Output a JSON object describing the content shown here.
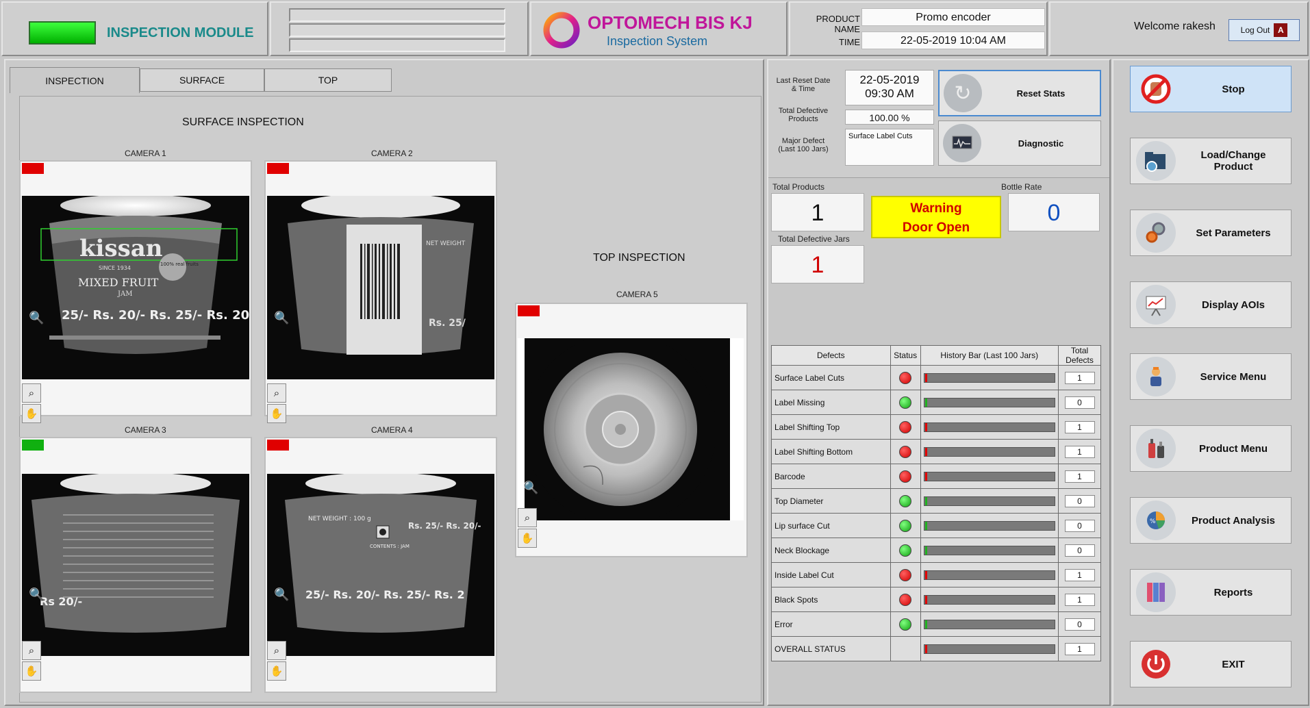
{
  "header": {
    "module_title": "INSPECTION MODULE",
    "logo_main": "OPTOMECH BIS KJ",
    "logo_sub": "Inspection System",
    "product_name_label": "PRODUCT NAME",
    "product_name_value": "Promo encoder",
    "time_label": "TIME",
    "time_value": "22-05-2019  10:04 AM",
    "welcome": "Welcome rakesh",
    "logout_label": "Log Out"
  },
  "tabs": [
    "INSPECTION",
    "SURFACE",
    "TOP"
  ],
  "inspection": {
    "surface_title": "SURFACE INSPECTION",
    "top_title": "TOP INSPECTION",
    "cameras": [
      {
        "label": "CAMERA 1",
        "flag": "#e00000"
      },
      {
        "label": "CAMERA 2",
        "flag": "#e00000"
      },
      {
        "label": "CAMERA 3",
        "flag": "#10b010"
      },
      {
        "label": "CAMERA 4",
        "flag": "#e00000"
      },
      {
        "label": "CAMERA 5",
        "flag": "#e00000"
      }
    ],
    "image_text": {
      "cam1_brand": "kissan",
      "cam1_since": "SINCE 1934",
      "cam1_product": "MIXED FRUIT",
      "cam1_jam": "JAM",
      "cam1_price": "25/- Rs. 20/- Rs. 25/- Rs. 20/",
      "cam1_badge": "100% real fruits",
      "cam2_net": "NET WEIGHT",
      "cam2_price": "Rs. 25/",
      "cam3_price": "Rs 20/-",
      "cam4_net": "NET WEIGHT : 100 g",
      "cam4_contents": "CONTENTS : JAM",
      "cam4_price": "25/- Rs. 20/- Rs. 25/- Rs. 2",
      "cam4_side_price": "Rs. 25/- Rs. 20/-"
    }
  },
  "stats": {
    "last_reset_label": "Last Reset Date & Time",
    "last_reset_date": "22-05-2019",
    "last_reset_time": "09:30 AM",
    "total_defective_label": "Total Defective Products",
    "total_defective_value": "100.00 %",
    "major_defect_label": "Major Defect (Last 100 Jars)",
    "major_defect_value": "Surface Label Cuts",
    "reset_label": "Reset  Stats",
    "diagnostic_label": "Diagnostic",
    "total_products_label": "Total Products",
    "total_products_value": "1",
    "warning_line1": "Warning",
    "warning_line2": "Door Open",
    "bottle_rate_label": "Bottle Rate",
    "bottle_rate_value": "0",
    "total_defective_jars_label": "Total Defective Jars",
    "total_defective_jars_value": "1"
  },
  "defect_table": {
    "headers": [
      "Defects",
      "Status",
      "History Bar (Last 100 Jars)",
      "Total Defects"
    ],
    "rows": [
      {
        "name": "Surface Label Cuts",
        "status": "red",
        "total": "1"
      },
      {
        "name": "Label Missing",
        "status": "green",
        "total": "0"
      },
      {
        "name": "Label Shifting Top",
        "status": "red",
        "total": "1"
      },
      {
        "name": "Label Shifting Bottom",
        "status": "red",
        "total": "1"
      },
      {
        "name": "Barcode",
        "status": "red",
        "total": "1"
      },
      {
        "name": "Top Diameter",
        "status": "green",
        "total": "0"
      },
      {
        "name": "Lip surface Cut",
        "status": "green",
        "total": "0"
      },
      {
        "name": "Neck Blockage",
        "status": "green",
        "total": "0"
      },
      {
        "name": "Inside Label Cut",
        "status": "red",
        "total": "1"
      },
      {
        "name": "Black Spots",
        "status": "red",
        "total": "1"
      },
      {
        "name": "Error",
        "status": "green",
        "total": "0"
      },
      {
        "name": "OVERALL STATUS",
        "status": "none",
        "total": "1"
      }
    ]
  },
  "sidebar": {
    "buttons": [
      {
        "label": "Stop",
        "icon": "stop-hand-icon"
      },
      {
        "label": "Load/Change\nProduct",
        "icon": "folder-load-icon"
      },
      {
        "label": "Set Parameters",
        "icon": "gears-icon"
      },
      {
        "label": "Display AOIs",
        "icon": "presentation-board-icon"
      },
      {
        "label": "Service Menu",
        "icon": "service-person-icon"
      },
      {
        "label": "Product Menu",
        "icon": "bottles-icon"
      },
      {
        "label": "Product Analysis",
        "icon": "pie-chart-icon"
      },
      {
        "label": "Reports",
        "icon": "binders-icon"
      },
      {
        "label": "EXIT",
        "icon": "power-icon"
      }
    ]
  },
  "colors": {
    "warning_bg": "#ffff00",
    "warning_text": "#d00000",
    "logo_text": "#c0169a",
    "module_title": "#1a8a8a",
    "bottle_rate": "#1050c0",
    "defective_jars": "#d00000"
  }
}
